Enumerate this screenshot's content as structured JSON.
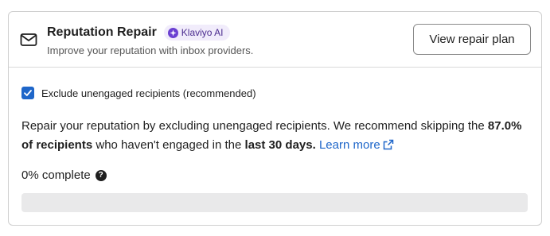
{
  "card": {
    "title": "Reputation Repair",
    "badge": "Klaviyo AI",
    "subtitle": "Improve your reputation with inbox providers.",
    "view_plan_label": "View repair plan",
    "icon": "mail-icon"
  },
  "checkbox": {
    "label": "Exclude unengaged recipients (recommended)",
    "checked": true
  },
  "description": {
    "part1": "Repair your reputation by excluding unengaged recipients. We recommend skipping the ",
    "bold1": "87.0% of recipients",
    "part2": " who haven't engaged in the ",
    "bold2": "last 30 days.",
    "link": "Learn more"
  },
  "progress": {
    "label": "0% complete",
    "value_percent": 0
  },
  "colors": {
    "accent": "#1e66c9",
    "badge_bg": "#f1ecfb",
    "badge_text": "#4b2b8f",
    "track": "#e9e9ea"
  }
}
